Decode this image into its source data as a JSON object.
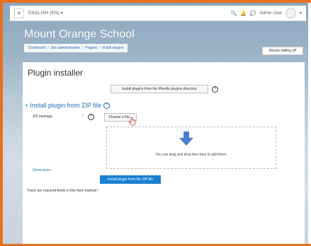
{
  "navbar": {
    "language": "ENGLISH (EN) ▾",
    "user_name": "Admin User",
    "caret": "▾",
    "menu_glyph": "≡",
    "search_glyph": "🔍",
    "notification_glyph": "🔔",
    "message_glyph": "💬"
  },
  "site": {
    "title": "Mount Orange School"
  },
  "breadcrumb": {
    "items": [
      "Dashboard",
      "Site administration",
      "Plugins",
      "Install plugins"
    ],
    "separator": "/"
  },
  "blocks_button": {
    "label": "Blocks editing off"
  },
  "page": {
    "heading": "Plugin installer",
    "directory_button": "Install plugins from the Moodle plugins directory",
    "help_glyph": "?"
  },
  "section": {
    "chevron": "▾",
    "title": "Install plugin from ZIP file",
    "help_glyph": "?"
  },
  "form": {
    "zip_label": "ZIP package",
    "required_glyph": "!",
    "choose_button": "Choose a file...",
    "dropzone_text": "You can drag and drop files here to add them.",
    "show_more": "Show more...",
    "submit_button": "Install plugin from the ZIP file",
    "required_note": "There are required fields in this form marked",
    "required_star": "*."
  },
  "colors": {
    "frame": "#e8701f",
    "link": "#1f6bbd",
    "primary_button": "#1a7fd1",
    "arrow": "#4a7fd0",
    "required": "#d9262e"
  }
}
